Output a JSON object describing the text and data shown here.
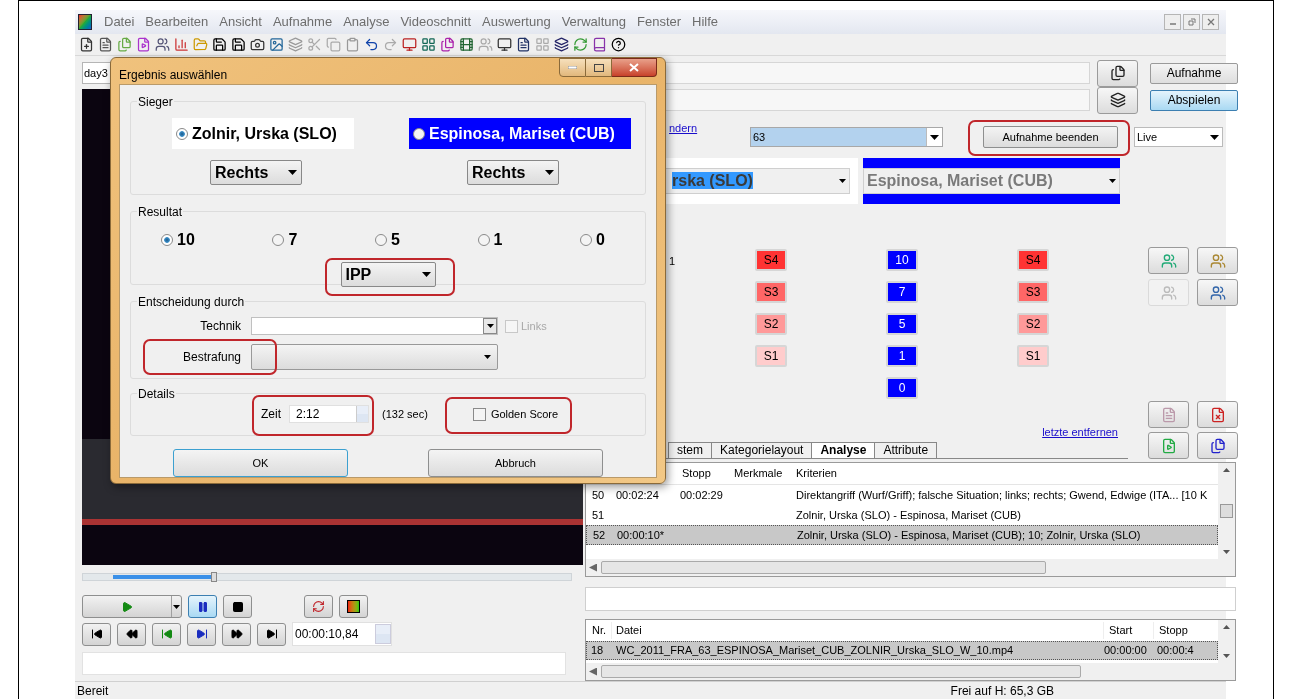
{
  "menu": [
    "Datei",
    "Bearbeiten",
    "Ansicht",
    "Aufnahme",
    "Analyse",
    "Videoschnitt",
    "Auswertung",
    "Verwaltung",
    "Fenster",
    "Hilfe"
  ],
  "left_panel": {
    "tab_label": "day3",
    "position_slider": {
      "level": 0.22
    },
    "time_field": {
      "value": "00:00:10,84"
    },
    "play_buttons": [
      {
        "kind": "play",
        "selected": false
      },
      {
        "kind": "pause",
        "selected": true
      },
      {
        "kind": "stop",
        "selected": false
      }
    ]
  },
  "right_panel": {
    "buttons": [
      {
        "label": "Aufnahme",
        "selected": false
      },
      {
        "label": "Abspielen",
        "selected": true
      }
    ],
    "link_fragment": "ndern",
    "category_combo": {
      "value": "63"
    },
    "end_button": {
      "label": "Aufnahme beenden",
      "highlighted": true
    },
    "mode_combo": {
      "value": "Live"
    },
    "athletes": [
      {
        "text": "rska (SLO)",
        "color": "#ffffff"
      },
      {
        "text": "Espinosa, Mariset (CUB)",
        "color": "#0000ff"
      }
    ],
    "label_fragment": "1",
    "score_columns": [
      [
        {
          "label": "S4",
          "color": "#ff3333"
        },
        {
          "label": "S3",
          "color": "#ff6666"
        },
        {
          "label": "S2",
          "color": "#ff9999"
        },
        {
          "label": "S1",
          "color": "#ffcccc"
        }
      ],
      [
        {
          "label": "10",
          "color": "#0000ff"
        },
        {
          "label": "7",
          "color": "#0000ff"
        },
        {
          "label": "5",
          "color": "#0000ff"
        },
        {
          "label": "1",
          "color": "#0000ff"
        },
        {
          "label": "0",
          "color": "#0000ff"
        }
      ],
      [
        {
          "label": "S4",
          "color": "#ff3333"
        },
        {
          "label": "S3",
          "color": "#ff6666"
        },
        {
          "label": "S2",
          "color": "#ff9999"
        },
        {
          "label": "S1",
          "color": "#ffcccc"
        }
      ]
    ],
    "remove_link": "letzte entfernen",
    "tabs": [
      {
        "label": "stem",
        "selected": false
      },
      {
        "label": "Kategorielayout",
        "selected": false
      },
      {
        "label": "Analyse",
        "selected": true
      },
      {
        "label": "Attribute",
        "selected": false
      }
    ],
    "events_table": {
      "columns": [
        "Stopp",
        "Merkmale",
        "Kriterien"
      ],
      "rows": [
        {
          "nr": "50",
          "start": "00:02:24",
          "stopp": "00:02:29",
          "kriterien": "Direktangriff (Wurf/Griff); falsche Situation; links; rechts; Gwend, Edwige (ITA... [10 K",
          "selected": false
        },
        {
          "nr": "51",
          "kriterien": "Zolnir, Urska (SLO) - Espinosa, Mariset (CUB)",
          "selected": false
        },
        {
          "nr": "52",
          "start": "00:00:10*",
          "kriterien": "Zolnir, Urska (SLO) - Espinosa, Mariset (CUB); 10; Zolnir, Urska (SLO)",
          "selected": true
        }
      ]
    },
    "files_table": {
      "columns": [
        "Nr.",
        "Datei",
        "Start",
        "Stopp"
      ],
      "rows": [
        {
          "nr": "18",
          "datei": "WC_2011_FRA_63_ESPINOSA_Mariset_CUB_ZOLNIR_Urska_SLO_W_10.mp4",
          "start": "00:00:00",
          "stopp": "00:00:4",
          "selected": true
        }
      ]
    }
  },
  "dialog": {
    "title": "Ergebnis auswählen",
    "sieger": {
      "legend": "Sieger",
      "options": [
        {
          "label": "Zolnir, Urska (SLO)",
          "selected": true,
          "color": "#ffffff",
          "side": "Rechts"
        },
        {
          "label": "Espinosa, Mariset (CUB)",
          "selected": false,
          "color": "#0000ff",
          "side": "Rechts"
        }
      ]
    },
    "resultat": {
      "legend": "Resultat",
      "options": [
        {
          "label": "10",
          "selected": true
        },
        {
          "label": "7",
          "selected": false
        },
        {
          "label": "5",
          "selected": false
        },
        {
          "label": "1",
          "selected": false
        },
        {
          "label": "0",
          "selected": false
        }
      ],
      "combo": {
        "value": "IPP",
        "highlighted": true
      }
    },
    "entscheidung": {
      "legend": "Entscheidung durch",
      "technik_label": "Technik",
      "links": {
        "label": "Links",
        "checked": false,
        "disabled": true
      },
      "bestrafung_label": "Bestrafung",
      "bestrafung_highlighted": true
    },
    "details": {
      "legend": "Details",
      "zeit_label": "Zeit",
      "zeit_value": "2:12",
      "zeit_highlighted": true,
      "seconds": "(132 sec)",
      "golden_score": {
        "label": "Golden Score",
        "checked": false,
        "highlighted": true
      }
    },
    "ok": "OK",
    "cancel": "Abbruch"
  },
  "status_bar": {
    "left": "Bereit",
    "right": "Frei auf H: 65,3 GB"
  }
}
